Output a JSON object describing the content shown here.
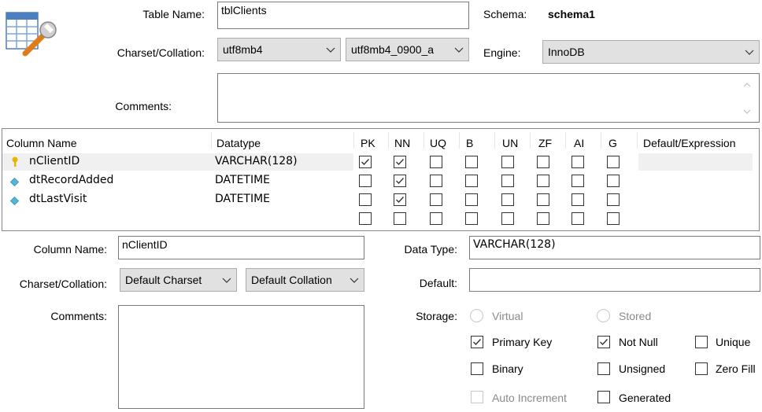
{
  "top": {
    "table_name_label": "Table Name:",
    "table_name_value": "tblClients",
    "schema_label": "Schema:",
    "schema_value": "schema1",
    "charset_label": "Charset/Collation:",
    "charset_value": "utf8mb4",
    "collation_value": "utf8mb4_0900_a",
    "engine_label": "Engine:",
    "engine_value": "InnoDB",
    "comments_label": "Comments:",
    "comments_value": ""
  },
  "grid": {
    "headers": [
      "Column Name",
      "Datatype",
      "PK",
      "NN",
      "UQ",
      "B",
      "UN",
      "ZF",
      "AI",
      "G",
      "Default/Expression"
    ],
    "rows": [
      {
        "name": "nClientID",
        "datatype": "VARCHAR(128)",
        "icon": "key-icon",
        "flags": [
          true,
          true,
          false,
          false,
          false,
          false,
          false,
          false
        ]
      },
      {
        "name": "dtRecordAdded",
        "datatype": "DATETIME",
        "icon": "diamond-icon",
        "flags": [
          false,
          true,
          false,
          false,
          false,
          false,
          false,
          false
        ]
      },
      {
        "name": "dtLastVisit",
        "datatype": "DATETIME",
        "icon": "diamond-icon",
        "flags": [
          false,
          true,
          false,
          false,
          false,
          false,
          false,
          false
        ]
      },
      {
        "name": "",
        "datatype": "",
        "icon": "",
        "flags": [
          false,
          false,
          false,
          false,
          false,
          false,
          false,
          false
        ]
      }
    ]
  },
  "detail": {
    "column_name_label": "Column Name:",
    "column_name_value": "nClientID",
    "data_type_label": "Data Type:",
    "data_type_value": "VARCHAR(128)",
    "charset_label": "Charset/Collation:",
    "charset_value": "Default Charset",
    "collation_value": "Default Collation",
    "default_label": "Default:",
    "default_value": "",
    "comments_label": "Comments:",
    "storage_label": "Storage:",
    "virtual_label": "Virtual",
    "stored_label": "Stored",
    "primary_key_label": "Primary Key",
    "not_null_label": "Not Null",
    "unique_label": "Unique",
    "binary_label": "Binary",
    "unsigned_label": "Unsigned",
    "zero_fill_label": "Zero Fill",
    "auto_increment_label": "Auto Increment",
    "generated_label": "Generated"
  },
  "colors": {
    "key": "#e8b400",
    "diamond": "#52b6d8",
    "check": "#333333",
    "disabled": "#8a8a8a"
  }
}
